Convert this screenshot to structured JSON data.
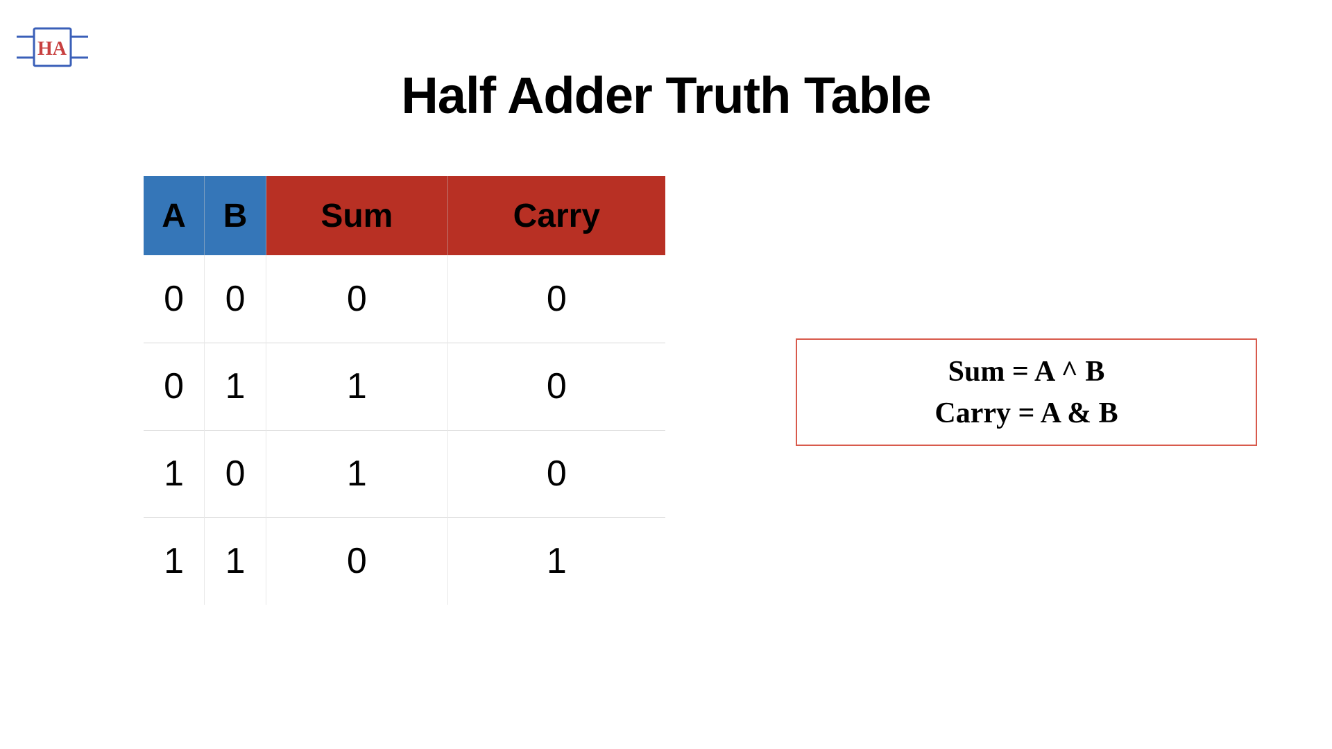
{
  "icon": {
    "label": "HA"
  },
  "title": "Half Adder Truth Table",
  "table": {
    "headers": {
      "a": "A",
      "b": "B",
      "sum": "Sum",
      "carry": "Carry"
    },
    "rows": [
      {
        "a": "0",
        "b": "0",
        "sum": "0",
        "carry": "0"
      },
      {
        "a": "0",
        "b": "1",
        "sum": "1",
        "carry": "0"
      },
      {
        "a": "1",
        "b": "0",
        "sum": "1",
        "carry": "0"
      },
      {
        "a": "1",
        "b": "1",
        "sum": "0",
        "carry": "1"
      }
    ]
  },
  "formulas": {
    "sum": "Sum = A ^ B",
    "carry": "Carry = A & B"
  },
  "colors": {
    "input_header": "#3576b8",
    "output_header": "#b83024",
    "formula_border": "#d85a4c"
  },
  "chart_data": {
    "type": "table",
    "title": "Half Adder Truth Table",
    "columns": [
      "A",
      "B",
      "Sum",
      "Carry"
    ],
    "rows": [
      [
        0,
        0,
        0,
        0
      ],
      [
        0,
        1,
        1,
        0
      ],
      [
        1,
        0,
        1,
        0
      ],
      [
        1,
        1,
        0,
        1
      ]
    ]
  }
}
